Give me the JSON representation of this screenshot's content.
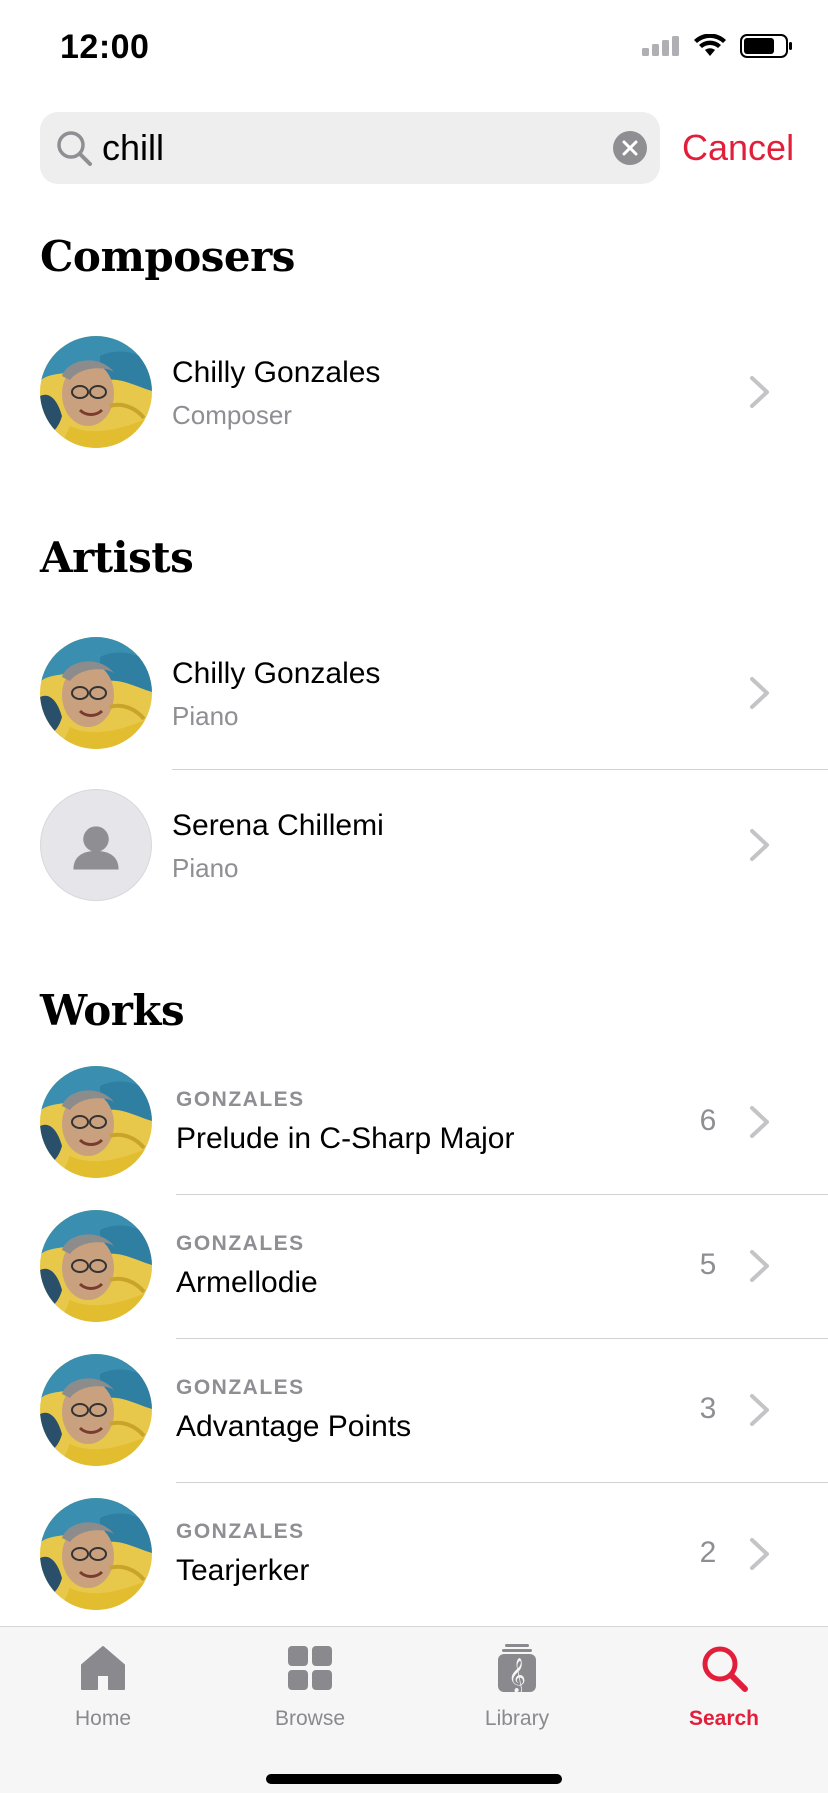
{
  "status": {
    "time": "12:00"
  },
  "search": {
    "value": "chill",
    "cancel_label": "Cancel"
  },
  "composers": {
    "title": "Composers",
    "items": [
      {
        "name": "Chilly Gonzales",
        "role": "Composer"
      }
    ]
  },
  "artists": {
    "title": "Artists",
    "items": [
      {
        "name": "Chilly Gonzales",
        "role": "Piano"
      },
      {
        "name": "Serena Chillemi",
        "role": "Piano"
      }
    ]
  },
  "works": {
    "title": "Works",
    "items": [
      {
        "composer": "GONZALES",
        "title": "Prelude in C-Sharp Major",
        "count": "6"
      },
      {
        "composer": "GONZALES",
        "title": "Armellodie",
        "count": "5"
      },
      {
        "composer": "GONZALES",
        "title": "Advantage Points",
        "count": "3"
      },
      {
        "composer": "GONZALES",
        "title": "Tearjerker",
        "count": "2"
      }
    ]
  },
  "tabbar": {
    "tabs": [
      {
        "label": "Home",
        "icon": "home-icon"
      },
      {
        "label": "Browse",
        "icon": "grid-icon"
      },
      {
        "label": "Library",
        "icon": "library-icon"
      },
      {
        "label": "Search",
        "icon": "search-icon"
      }
    ],
    "active": "Search"
  },
  "colors": {
    "accent": "#e21f3a",
    "secondary_text": "#8e8e93"
  }
}
